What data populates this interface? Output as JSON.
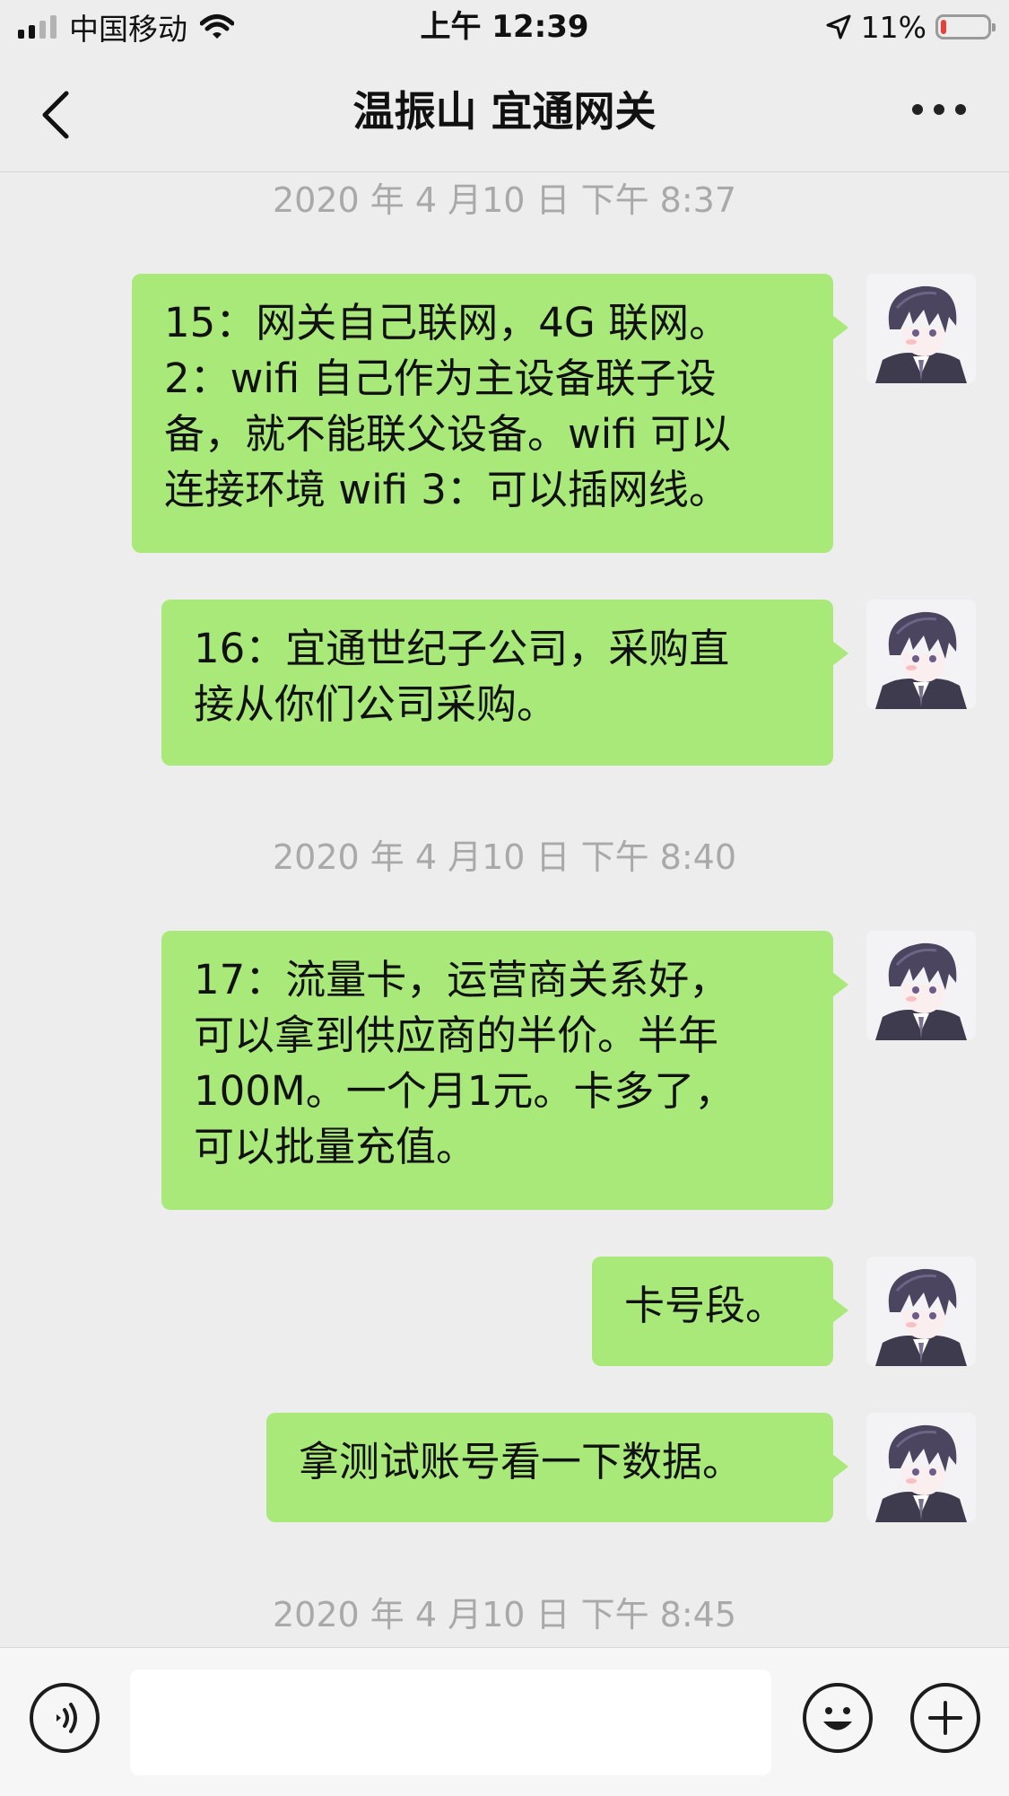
{
  "status_bar": {
    "carrier": "中国移动",
    "time": "上午 12:39",
    "battery_text": "11%",
    "battery_level_percent": 11,
    "icons": [
      "signal-icon",
      "wifi-icon",
      "location-arrow-icon",
      "battery-icon"
    ]
  },
  "header": {
    "title": "温振山 宜通网关",
    "back_icon": "chevron-left-icon",
    "more_icon": "more-dots-icon"
  },
  "messages": [
    {
      "type": "timestamp",
      "text": "2020 年 4 月10 日  下午 8:37"
    },
    {
      "type": "bubble",
      "sender": "self",
      "text": "15：网关自己联网，4G 联网。\n2：wifi 自己作为主设备联子设\n备，就不能联父设备。wifi 可以\n连接环境 wifi 3：可以插网线。"
    },
    {
      "type": "bubble",
      "sender": "self",
      "text": "16：宜通世纪子公司，采购直\n接从你们公司采购。"
    },
    {
      "type": "timestamp",
      "text": "2020 年 4 月10 日  下午 8:40"
    },
    {
      "type": "bubble",
      "sender": "self",
      "text": "17：流量卡，运营商关系好，\n可以拿到供应商的半价。半年\n100M。一个月1元。卡多了，\n可以批量充值。"
    },
    {
      "type": "bubble",
      "sender": "self",
      "text": "卡号段。"
    },
    {
      "type": "bubble",
      "sender": "self",
      "text": "拿测试账号看一下数据。"
    },
    {
      "type": "timestamp",
      "text": "2020 年 4 月10 日  下午 8:45"
    }
  ],
  "input_bar": {
    "value": "",
    "icons": [
      "voice-icon",
      "emoji-icon",
      "plus-icon"
    ]
  },
  "colors": {
    "background": "#ededed",
    "bubble_self": "#a9e979",
    "timestamp_text": "#a9a9a9",
    "battery_low": "#e8413a"
  }
}
